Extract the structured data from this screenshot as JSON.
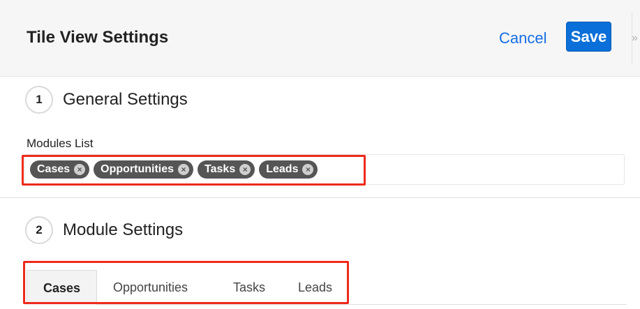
{
  "header": {
    "title": "Tile View Settings",
    "cancel_label": "Cancel",
    "save_label": "Save",
    "collapse_glyph": "»"
  },
  "steps": [
    {
      "number": "1",
      "title": "General Settings"
    },
    {
      "number": "2",
      "title": "Module Settings"
    }
  ],
  "modules_list": {
    "label": "Modules List",
    "selected": [
      {
        "label": "Cases",
        "remove": "×"
      },
      {
        "label": "Opportunities",
        "remove": "×"
      },
      {
        "label": "Tasks",
        "remove": "×"
      },
      {
        "label": "Leads",
        "remove": "×"
      }
    ]
  },
  "module_tabs": {
    "active": "Cases",
    "items": [
      {
        "label": "Cases"
      },
      {
        "label": "Opportunities"
      },
      {
        "label": "Tasks"
      },
      {
        "label": "Leads"
      }
    ]
  },
  "colors": {
    "accent": "#0a6fd8",
    "link": "#176de5",
    "highlight": "#ee2a1b",
    "pill": "#555555"
  }
}
